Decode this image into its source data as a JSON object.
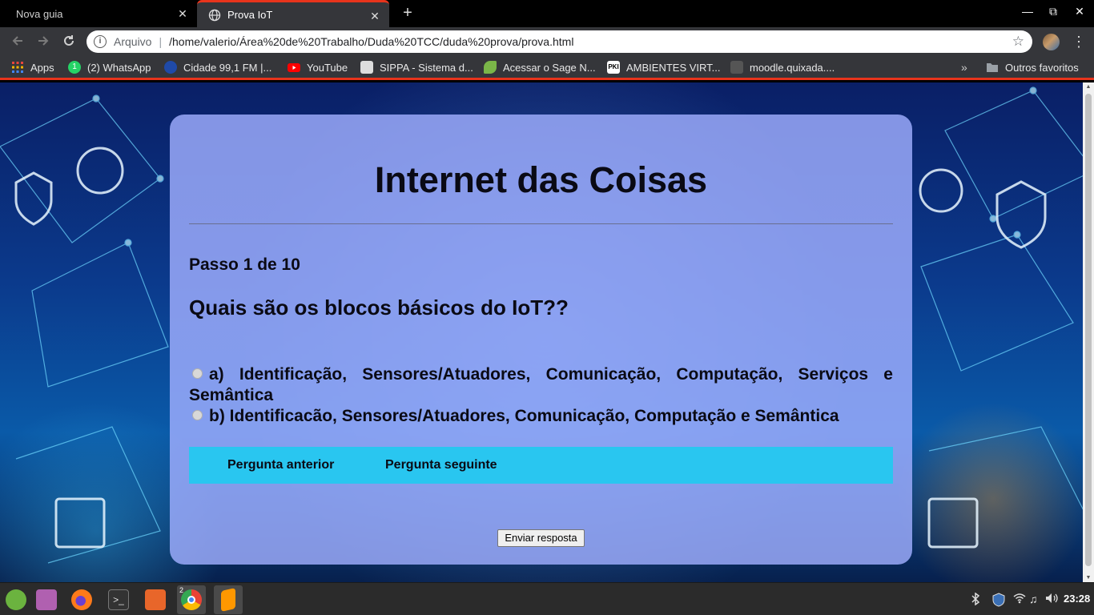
{
  "browser": {
    "tabs": [
      {
        "label": "Nova guia",
        "active": false
      },
      {
        "label": "Prova IoT",
        "active": true
      }
    ],
    "new_tab_symbol": "+",
    "close_symbol": "✕",
    "window_controls": {
      "minimize": "—",
      "maximize": "⧉",
      "close": "✕"
    },
    "address": {
      "scheme": "Arquivo",
      "url": "/home/valerio/Área%20de%20Trabalho/Duda%20TCC/duda%20prova/prova.html"
    },
    "bookmarks": [
      {
        "label": "Apps",
        "icon": "apps-grid-icon",
        "color": "#e8453c"
      },
      {
        "label": "(2) WhatsApp",
        "icon": "whatsapp-icon",
        "color": "#25d366"
      },
      {
        "label": "Cidade 99,1 FM |...",
        "icon": "radio-icon",
        "color": "#1f4aa8"
      },
      {
        "label": "YouTube",
        "icon": "youtube-icon",
        "color": "#ff0000"
      },
      {
        "label": "SIPPA - Sistema d...",
        "icon": "sippa-icon",
        "color": "#dddddd"
      },
      {
        "label": "Acessar o Sage N...",
        "icon": "sage-icon",
        "color": "#7ab648"
      },
      {
        "label": "AMBIENTES VIRT...",
        "icon": "pki-icon",
        "color": "#ffffff"
      },
      {
        "label": "moodle.quixada....",
        "icon": "moodle-icon",
        "color": "#555555"
      }
    ],
    "overflow_symbol": "»",
    "other_bookmarks": "Outros favoritos"
  },
  "page": {
    "title": "Internet das Coisas",
    "step": "Passo 1 de 10",
    "question": "Quais são os blocos básicos do IoT??",
    "options": [
      {
        "text": "a) Identificação, Sensores/Atuadores, Comunicação, Computação, Serviços e Semântica"
      },
      {
        "text": "b) Identificacão, Sensores/Atuadores, Comunicação, Computação e Semântica"
      }
    ],
    "prev_label": "Pergunta anterior",
    "next_label": "Pergunta seguinte",
    "submit_label": "Enviar resposta",
    "colors": {
      "card": "#a0afff",
      "nav_bar": "#29c6f0",
      "tab_accent": "#e8341c"
    }
  },
  "taskbar": {
    "apps": [
      {
        "name": "mint-menu-icon",
        "color": "#6bb33f",
        "running": false
      },
      {
        "name": "show-desktop-icon",
        "color": "#b060b0",
        "running": false
      },
      {
        "name": "firefox-icon",
        "color": "#ff7a1a",
        "running": false
      },
      {
        "name": "terminal-icon",
        "color": "#333333",
        "running": false
      },
      {
        "name": "files-icon",
        "color": "#e8662a",
        "running": false
      },
      {
        "name": "chrome-icon",
        "color": "#4285f4",
        "running": true,
        "badge": "2"
      },
      {
        "name": "sublime-icon",
        "color": "#ff9800",
        "running": true
      }
    ],
    "clock": "23:28"
  }
}
